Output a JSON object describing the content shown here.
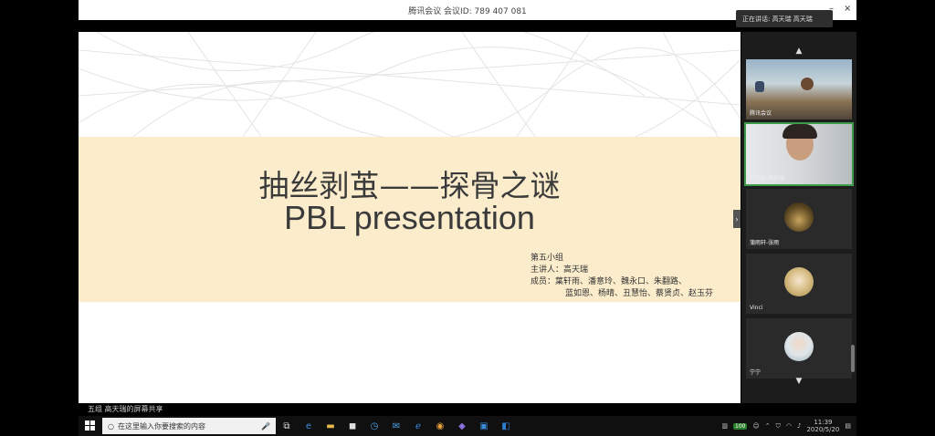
{
  "window": {
    "meeting_id": "腾讯会议 会议ID: 789 407 081",
    "minimize_label": "–",
    "close_label": "×"
  },
  "speaking": {
    "text": "正在讲话: 高天瑞 高天瑞"
  },
  "slide": {
    "title_cn": "抽丝剥茧——探骨之谜",
    "title_en": "PBL presentation",
    "group_lines": [
      "第五小组",
      "主讲人：高天瑞",
      "成员：葉轩雨、潘意玲、魏永口、朱翻路、",
      "蓝如恩、杨晴、丑慧怡、蔡贤贞、赵玉芬"
    ],
    "side_arrow": "›"
  },
  "participants": {
    "nav_up": "▲",
    "nav_down": "▼",
    "tiles": [
      {
        "name": "腾讯会议"
      },
      {
        "name": "高天瑞 高天瑞"
      },
      {
        "name": "蒲雨轩-张雨"
      },
      {
        "name": "Vinci"
      },
      {
        "name": "宁宁"
      }
    ]
  },
  "bottom_label": "五组 高天瑞的屏幕共享",
  "taskbar": {
    "start_icon": "windows-logo",
    "search_placeholder": "在这里输入你要搜索的内容",
    "clock_time": "11:39",
    "clock_date": "2020/5/20",
    "battery": "100"
  },
  "colors": {
    "band": "#fbeccc",
    "active_border": "#3d9a4a",
    "panel_bg": "#1c1c1c"
  }
}
